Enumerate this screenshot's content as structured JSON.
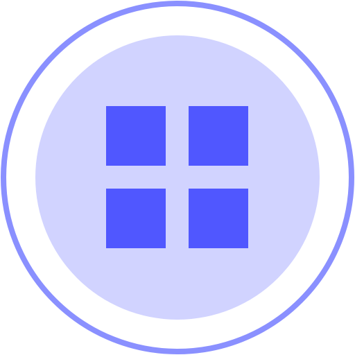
{
  "icon": {
    "name": "grid-menu-icon",
    "colors": {
      "ring": "#8a90ff",
      "disc": "#d1d3ff",
      "tiles": "#5057ff",
      "background": "#ffffff"
    },
    "tiles": [
      "top-left",
      "top-right",
      "bottom-left",
      "bottom-right"
    ]
  }
}
